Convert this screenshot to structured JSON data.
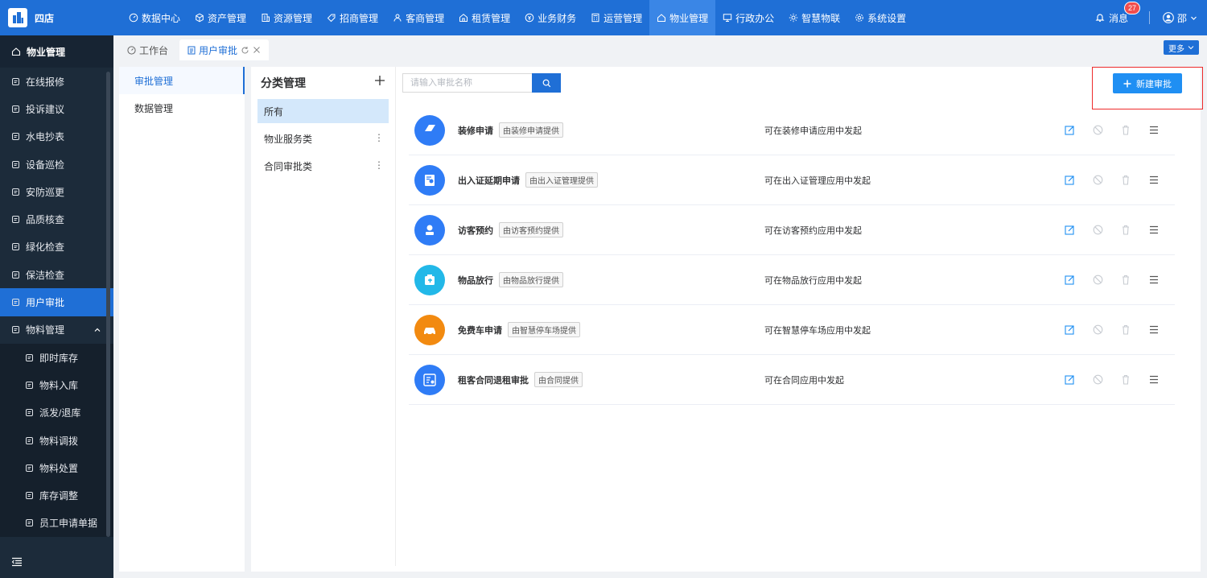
{
  "brand": {
    "name": "四店"
  },
  "topnav": [
    {
      "label": "数据中心",
      "icon": "dashboard-icon"
    },
    {
      "label": "资产管理",
      "icon": "cube-icon"
    },
    {
      "label": "资源管理",
      "icon": "building-icon"
    },
    {
      "label": "招商管理",
      "icon": "tag-icon"
    },
    {
      "label": "客商管理",
      "icon": "users-icon"
    },
    {
      "label": "租赁管理",
      "icon": "house-icon"
    },
    {
      "label": "业务财务",
      "icon": "coin-icon"
    },
    {
      "label": "运营管理",
      "icon": "calculator-icon"
    },
    {
      "label": "物业管理",
      "icon": "home-icon",
      "active": true
    },
    {
      "label": "行政办公",
      "icon": "monitor-icon"
    },
    {
      "label": "智慧物联",
      "icon": "sun-icon"
    },
    {
      "label": "系统设置",
      "icon": "gear-icon"
    }
  ],
  "header": {
    "messages_label": "消息",
    "messages_count": "27",
    "user_name": "邵"
  },
  "sidebar": {
    "title": "物业管理",
    "items": [
      {
        "label": "在线报修"
      },
      {
        "label": "投诉建议"
      },
      {
        "label": "水电抄表"
      },
      {
        "label": "设备巡检"
      },
      {
        "label": "安防巡更"
      },
      {
        "label": "品质核查"
      },
      {
        "label": "绿化检查"
      },
      {
        "label": "保洁检查"
      },
      {
        "label": "用户审批"
      },
      {
        "label": "物料管理"
      }
    ],
    "sub_items": [
      {
        "label": "即时库存"
      },
      {
        "label": "物料入库"
      },
      {
        "label": "派发/退库"
      },
      {
        "label": "物料调拨"
      },
      {
        "label": "物料处置"
      },
      {
        "label": "库存调整"
      },
      {
        "label": "员工申请单据"
      }
    ]
  },
  "tabs": [
    {
      "label": "工作台"
    },
    {
      "label": "用户审批"
    }
  ],
  "more_label": "更多",
  "panel1": {
    "items": [
      {
        "label": "审批管理"
      },
      {
        "label": "数据管理"
      }
    ]
  },
  "category": {
    "title": "分类管理",
    "items": [
      {
        "label": "所有"
      },
      {
        "label": "物业服务类"
      },
      {
        "label": "合同审批类"
      }
    ]
  },
  "search": {
    "placeholder": "请输入审批名称",
    "value": ""
  },
  "new_button_label": "新建审批",
  "colors": {
    "primary": "#1f6fd6",
    "highlight": "#ee2b2b"
  },
  "approvals": [
    {
      "name": "装修申请",
      "tag": "由装修申请提供",
      "desc": "可在装修申请应用中发起",
      "icon_color": "#2f7cf6"
    },
    {
      "name": "出入证延期申请",
      "tag": "由出入证管理提供",
      "desc": "可在出入证管理应用中发起",
      "icon_color": "#2f7cf6"
    },
    {
      "name": "访客预约",
      "tag": "由访客预约提供",
      "desc": "可在访客预约应用中发起",
      "icon_color": "#2f7cf6"
    },
    {
      "name": "物品放行",
      "tag": "由物品放行提供",
      "desc": "可在物品放行应用中发起",
      "icon_color": "#22b8e8"
    },
    {
      "name": "免费车申请",
      "tag": "由智慧停车场提供",
      "desc": "可在智慧停车场应用中发起",
      "icon_color": "#f28a10"
    },
    {
      "name": "租客合同退租审批",
      "tag": "由合同提供",
      "desc": "可在合同应用中发起",
      "icon_color": "#2f7cf6"
    }
  ]
}
